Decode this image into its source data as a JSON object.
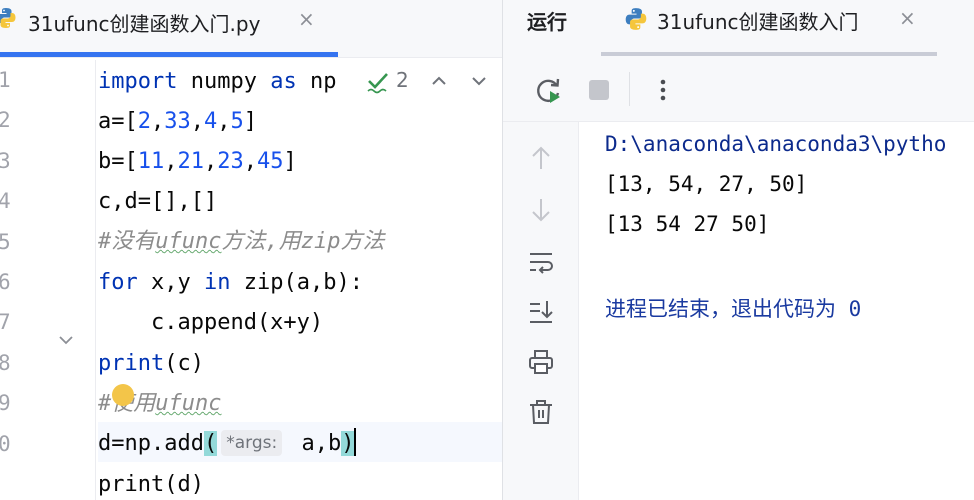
{
  "editor": {
    "tab": {
      "title": "31ufunc创建函数入门.py",
      "close": "×"
    },
    "inspection": {
      "count": "2"
    },
    "line_numbers": [
      "1",
      "2",
      "3",
      "4",
      "5",
      "6",
      "7",
      "8",
      "9",
      "0"
    ],
    "lines": [
      {
        "kw1": "import",
        "t1": " numpy ",
        "kw2": "as",
        "t2": " np"
      },
      {
        "t1": "a=[",
        "n1": "2",
        "c1": ",",
        "n2": "33",
        "c2": ",",
        "n3": "4",
        "c3": ",",
        "n4": "5",
        "t2": "]"
      },
      {
        "t1": "b=[",
        "n1": "11",
        "c1": ",",
        "n2": "21",
        "c2": ",",
        "n3": "23",
        "c3": ",",
        "n4": "45",
        "t2": "]"
      },
      {
        "t1": "c,d=[],[]"
      },
      {
        "c_hash": "#没有",
        "c_ufunc": "ufunc",
        "c_mid": "方法,用",
        "c_zip": "zip",
        "c_end": "方法"
      },
      {
        "kw1": "for",
        "t1": " x,y ",
        "kw2": "in",
        "t2": " zip(a,b):"
      },
      {
        "t1": "    c.append(x+y)"
      },
      {
        "t1": "print",
        "t2": "(c)"
      },
      {
        "c_hash": "#使用",
        "c_ufunc": "ufunc"
      },
      {
        "t1": "d=np.add",
        "p1": "(",
        "hint": "*args:",
        "t2": " a,b",
        "p2": ")"
      },
      {
        "t1": "print(d)"
      }
    ]
  },
  "run": {
    "label": "运行",
    "tab": {
      "title": "31ufunc创建函数入门",
      "close": "×"
    },
    "console": [
      "D:\\anaconda\\anaconda3\\pytho",
      "[13, 54, 27, 50]",
      "[13 54 27 50]",
      "进程已结束，退出代码为 0"
    ]
  },
  "colors": {
    "accent": "#3574f0",
    "keyword": "#0033b3",
    "number": "#1750eb",
    "comment": "#8c8c8c",
    "console_path": "#0c2a8c"
  },
  "icons": [
    "python-file-icon",
    "check-icon",
    "chevron-up-icon",
    "chevron-down-icon",
    "rerun-icon",
    "stop-icon",
    "more-icon",
    "scroll-up-icon",
    "scroll-down-icon",
    "soft-wrap-icon",
    "scroll-to-end-icon",
    "print-icon",
    "trash-icon",
    "intention-bulb-icon",
    "fold-icon"
  ]
}
